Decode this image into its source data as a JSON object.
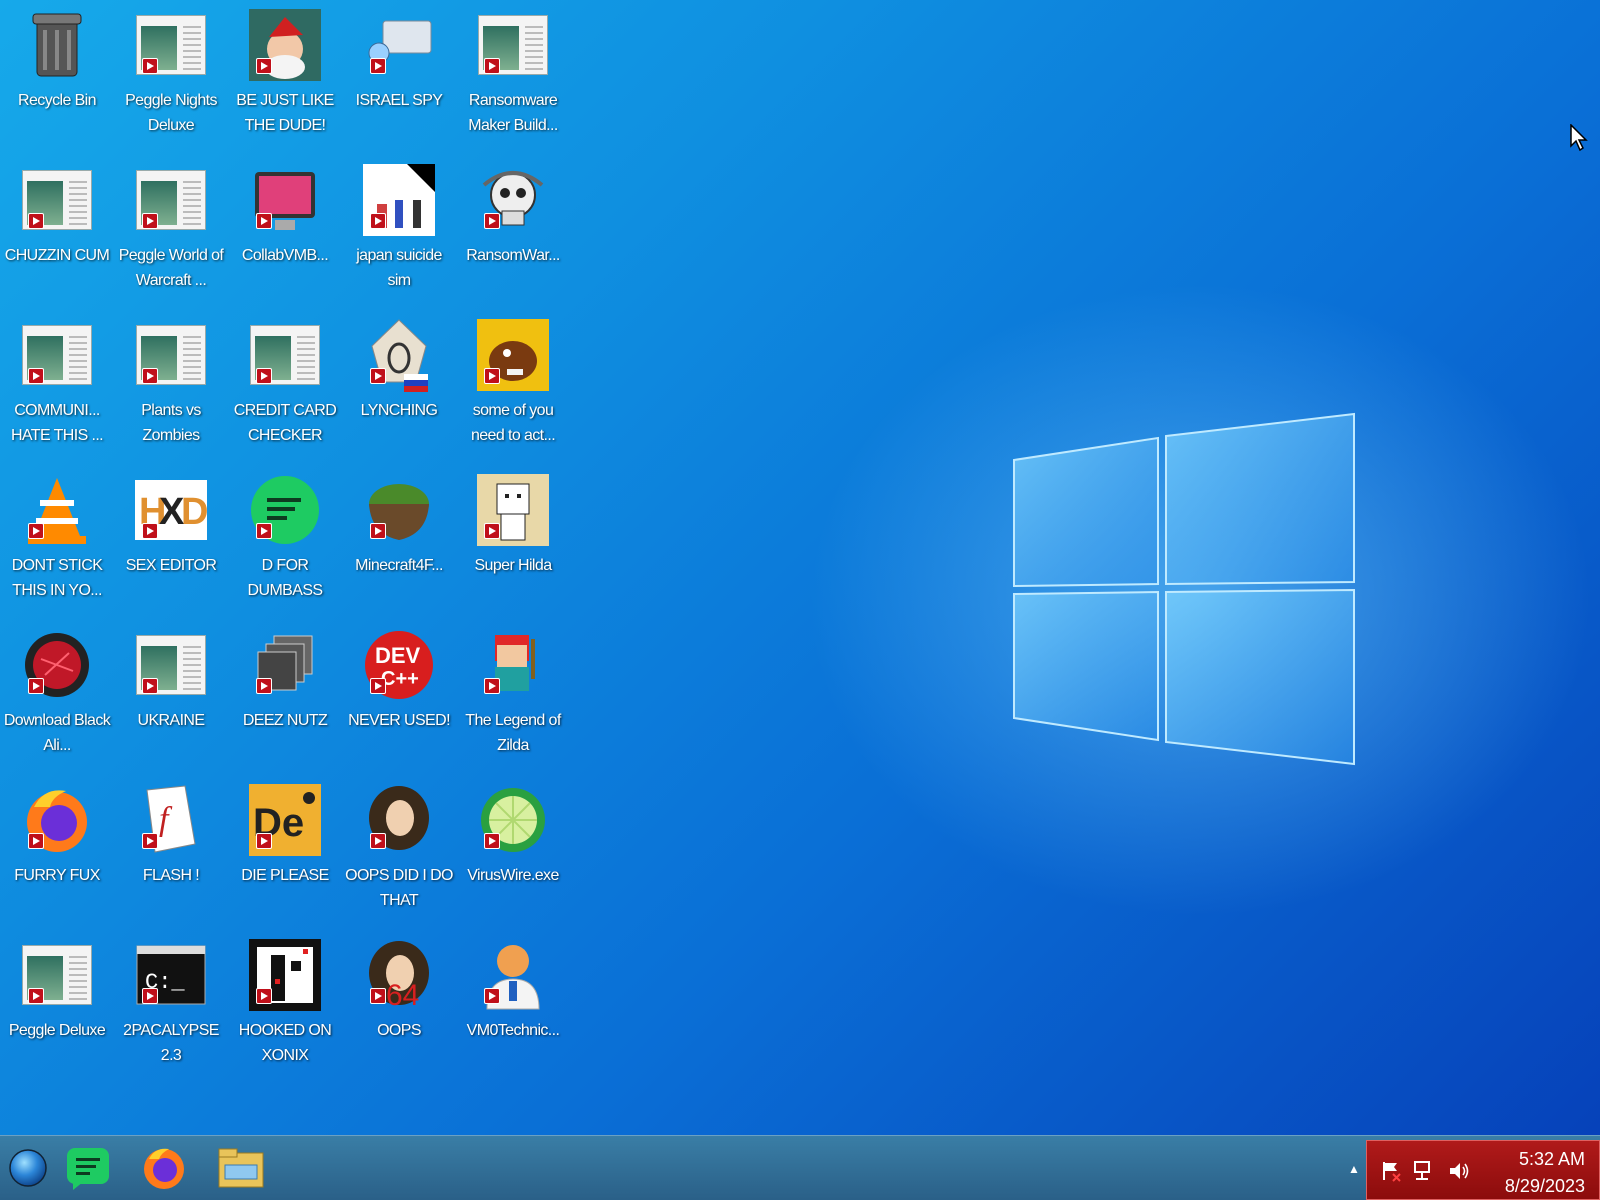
{
  "desktop": {
    "icons": [
      {
        "label": "Recycle Bin",
        "icon": "recycle-bin-icon"
      },
      {
        "label": "Peggle Nights Deluxe",
        "icon": "app-window-icon"
      },
      {
        "label": "BE JUST LIKE THE DUDE!",
        "icon": "santa-icon"
      },
      {
        "label": "ISRAEL SPY",
        "icon": "network-monitor-icon"
      },
      {
        "label": "Ransomware Maker Build...",
        "icon": "app-window-icon"
      },
      {
        "label": "CHUZZIN CUM",
        "icon": "app-window-icon"
      },
      {
        "label": "Peggle World of Warcraft ...",
        "icon": "app-window-icon"
      },
      {
        "label": "CollabVMB...",
        "icon": "pink-monitor-icon"
      },
      {
        "label": "japan suicide sim",
        "icon": "chess-pieces-icon"
      },
      {
        "label": "RansomWar...",
        "icon": "skull-icon"
      },
      {
        "label": "COMMUNI... HATE THIS ...",
        "icon": "app-window-icon"
      },
      {
        "label": "Plants vs Zombies",
        "icon": "app-window-icon"
      },
      {
        "label": "CREDIT CARD CHECKER",
        "icon": "app-window-icon"
      },
      {
        "label": "LYNCHING",
        "icon": "noose-icon"
      },
      {
        "label": "some of you need to act...",
        "icon": "dog-icon"
      },
      {
        "label": "DONT STICK THIS IN YO...",
        "icon": "vlc-cone-icon"
      },
      {
        "label": "SEX EDITOR",
        "icon": "hxd-icon"
      },
      {
        "label": "D FOR DUMBASS",
        "icon": "green-chat-icon"
      },
      {
        "label": "Minecraft4F...",
        "icon": "grass-block-icon"
      },
      {
        "label": "Super Hilda",
        "icon": "pixel-character-icon"
      },
      {
        "label": "Download Black Ali...",
        "icon": "red-orb-icon"
      },
      {
        "label": "UKRAINE",
        "icon": "app-window-icon"
      },
      {
        "label": "DEEZ NUTZ",
        "icon": "stacked-windows-icon"
      },
      {
        "label": "NEVER USED!",
        "icon": "dev-cpp-icon"
      },
      {
        "label": "The Legend of Zilda",
        "icon": "pixel-hero-icon"
      },
      {
        "label": "FURRY FUX",
        "icon": "firefox-icon"
      },
      {
        "label": "FLASH !",
        "icon": "flash-document-icon"
      },
      {
        "label": "DIE PLEASE",
        "icon": "de-icon"
      },
      {
        "label": "OOPS DID I DO THAT",
        "icon": "portrait-icon"
      },
      {
        "label": "VirusWire.exe",
        "icon": "lime-icon"
      },
      {
        "label": "Peggle Deluxe",
        "icon": "app-window-icon"
      },
      {
        "label": "2PACALYPSE 2.3",
        "icon": "terminal-icon"
      },
      {
        "label": "HOOKED ON XONIX",
        "icon": "xonix-icon"
      },
      {
        "label": "OOPS",
        "icon": "portrait-64-icon"
      },
      {
        "label": "VM0Technic...",
        "icon": "doctor-icon"
      }
    ]
  },
  "taskbar": {
    "start": "start-orb-icon",
    "pinned": [
      {
        "name": "chat-app",
        "icon": "green-chat-icon"
      },
      {
        "name": "firefox",
        "icon": "firefox-icon"
      },
      {
        "name": "file-explorer",
        "icon": "folder-icon"
      }
    ],
    "tray_arrow": "▲",
    "clock_time": "5:32 AM",
    "clock_date": "8/29/2023"
  },
  "colors": {
    "desktop_blue": "#0f8fe0",
    "taskbar": "#2a6088",
    "tray_red": "#a01414"
  }
}
